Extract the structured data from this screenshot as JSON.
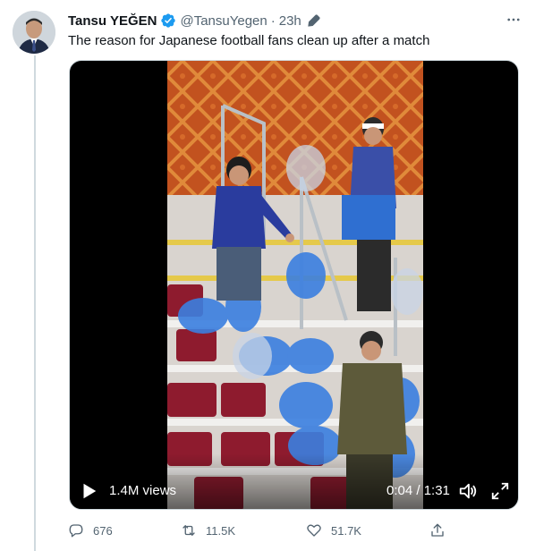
{
  "tweet": {
    "author_name": "Tansu YEĞEN",
    "handle": "@TansuYegen",
    "separator": "·",
    "time": "23h",
    "text": "The reason for Japanese football fans clean up after a match"
  },
  "video": {
    "views": "1.4M views",
    "timecode": "0:04 / 1:31",
    "progress": 0.044
  },
  "actions": {
    "replies": "676",
    "retweets": "11.5K",
    "likes": "51.7K"
  },
  "icons": [
    "verified-icon",
    "edit-icon",
    "more-icon",
    "play-icon",
    "volume-icon",
    "fullscreen-icon",
    "reply-icon",
    "retweet-icon",
    "like-icon",
    "share-icon"
  ],
  "colors": {
    "verified": "#1d9bf0",
    "muted_text": "#536471",
    "stadium_seat": "#8e1b2e",
    "jersey": "#2a3c9e",
    "bag": "#3b7fe0"
  }
}
